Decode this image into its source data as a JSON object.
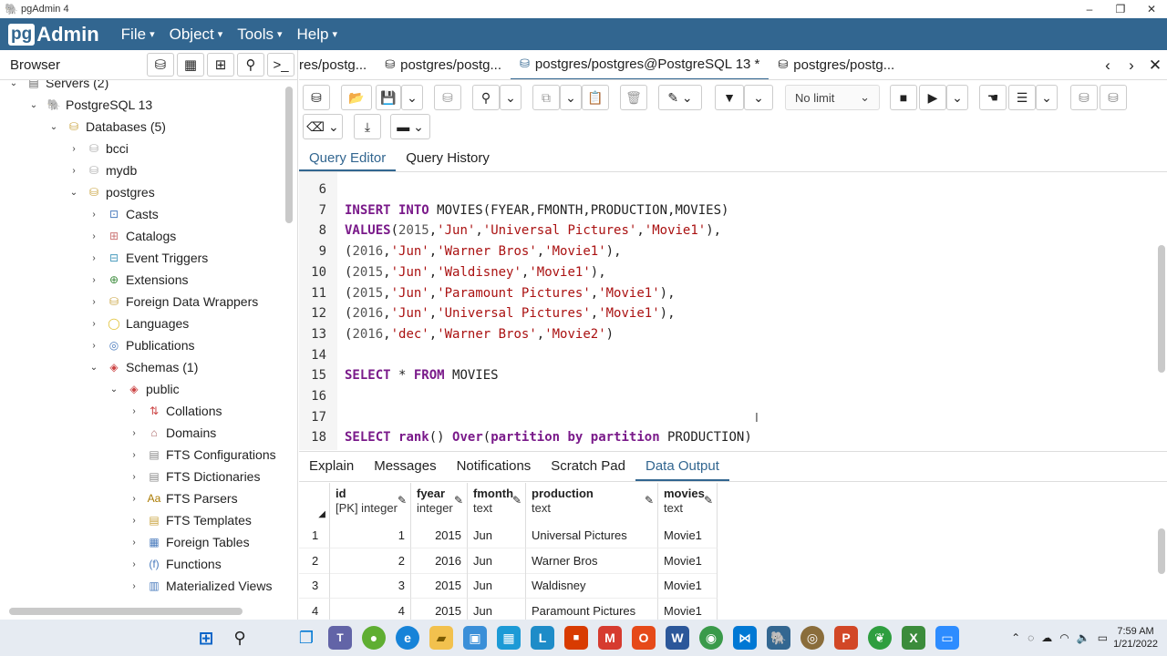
{
  "window": {
    "title": "pgAdmin 4",
    "min": "–",
    "max": "❐",
    "close": "✕"
  },
  "brand": {
    "pg": "pg",
    "admin": "Admin"
  },
  "menu": [
    {
      "label": "File"
    },
    {
      "label": "Object"
    },
    {
      "label": "Tools"
    },
    {
      "label": "Help"
    }
  ],
  "browser": {
    "title": "Browser",
    "tree": [
      {
        "label": "Servers (2)",
        "level": 0,
        "arrow": "⌄"
      },
      {
        "label": "PostgreSQL 13",
        "level": 1,
        "arrow": "⌄"
      },
      {
        "label": "Databases (5)",
        "level": 2,
        "arrow": "⌄"
      },
      {
        "label": "bcci",
        "level": 3,
        "arrow": "›"
      },
      {
        "label": "mydb",
        "level": 3,
        "arrow": "›"
      },
      {
        "label": "postgres",
        "level": 3,
        "arrow": "⌄"
      },
      {
        "label": "Casts",
        "level": 4,
        "arrow": "›"
      },
      {
        "label": "Catalogs",
        "level": 4,
        "arrow": "›"
      },
      {
        "label": "Event Triggers",
        "level": 4,
        "arrow": "›"
      },
      {
        "label": "Extensions",
        "level": 4,
        "arrow": "›"
      },
      {
        "label": "Foreign Data Wrappers",
        "level": 4,
        "arrow": "›"
      },
      {
        "label": "Languages",
        "level": 4,
        "arrow": "›"
      },
      {
        "label": "Publications",
        "level": 4,
        "arrow": "›"
      },
      {
        "label": "Schemas (1)",
        "level": 4,
        "arrow": "⌄"
      },
      {
        "label": "public",
        "level": 5,
        "arrow": "⌄"
      },
      {
        "label": "Collations",
        "level": 6,
        "arrow": "›"
      },
      {
        "label": "Domains",
        "level": 6,
        "arrow": "›"
      },
      {
        "label": "FTS Configurations",
        "level": 6,
        "arrow": "›"
      },
      {
        "label": "FTS Dictionaries",
        "level": 6,
        "arrow": "›"
      },
      {
        "label": "FTS Parsers",
        "level": 6,
        "arrow": "›"
      },
      {
        "label": "FTS Templates",
        "level": 6,
        "arrow": "›"
      },
      {
        "label": "Foreign Tables",
        "level": 6,
        "arrow": "›"
      },
      {
        "label": "Functions",
        "level": 6,
        "arrow": "›"
      },
      {
        "label": "Materialized Views",
        "level": 6,
        "arrow": "›"
      }
    ]
  },
  "tabs": [
    {
      "label": "res/postg..."
    },
    {
      "label": "postgres/postg..."
    },
    {
      "label": "postgres/postgres@PostgreSQL 13 *"
    },
    {
      "label": "postgres/postg..."
    }
  ],
  "toolbar": {
    "limit": "No limit"
  },
  "subtabs": [
    {
      "label": "Query Editor"
    },
    {
      "label": "Query History"
    }
  ],
  "editor": {
    "lines": [
      {
        "n": "6",
        "html": ""
      },
      {
        "n": "7",
        "html": "<span class='kw'>INSERT INTO</span> MOVIES(FYEAR,FMONTH,PRODUCTION,MOVIES)"
      },
      {
        "n": "8",
        "html": "<span class='kw'>VALUES</span>(<span class='num'>2015</span>,<span class='str'>'Jun'</span>,<span class='str'>'Universal Pictures'</span>,<span class='str'>'Movie1'</span>),"
      },
      {
        "n": "9",
        "html": "(<span class='num'>2016</span>,<span class='str'>'Jun'</span>,<span class='str'>'Warner Bros'</span>,<span class='str'>'Movie1'</span>),"
      },
      {
        "n": "10",
        "html": "(<span class='num'>2015</span>,<span class='str'>'Jun'</span>,<span class='str'>'Waldisney'</span>,<span class='str'>'Movie1'</span>),"
      },
      {
        "n": "11",
        "html": "(<span class='num'>2015</span>,<span class='str'>'Jun'</span>,<span class='str'>'Paramount Pictures'</span>,<span class='str'>'Movie1'</span>),"
      },
      {
        "n": "12",
        "html": "(<span class='num'>2016</span>,<span class='str'>'Jun'</span>,<span class='str'>'Universal Pictures'</span>,<span class='str'>'Movie1'</span>),"
      },
      {
        "n": "13",
        "html": "(<span class='num'>2016</span>,<span class='str'>'dec'</span>,<span class='str'>'Warner Bros'</span>,<span class='str'>'Movie2'</span>)"
      },
      {
        "n": "14",
        "html": ""
      },
      {
        "n": "15",
        "html": "<span class='kw'>SELECT</span> * <span class='kw'>FROM</span> MOVIES"
      },
      {
        "n": "16",
        "html": ""
      },
      {
        "n": "17",
        "html": ""
      },
      {
        "n": "18",
        "html": "<span class='kw'>SELECT</span> <span class='kw'>rank</span>() <span class='kw'>Over</span>(<span class='kw'>partition by partition</span> PRODUCTION)"
      }
    ]
  },
  "result_tabs": [
    {
      "label": "Explain"
    },
    {
      "label": "Messages"
    },
    {
      "label": "Notifications"
    },
    {
      "label": "Scratch Pad"
    },
    {
      "label": "Data Output"
    }
  ],
  "grid": {
    "columns": [
      {
        "name": "id",
        "type": "[PK] integer"
      },
      {
        "name": "fyear",
        "type": "integer"
      },
      {
        "name": "fmonth",
        "type": "text"
      },
      {
        "name": "production",
        "type": "text"
      },
      {
        "name": "movies",
        "type": "text"
      }
    ],
    "rows": [
      [
        "1",
        "1",
        "2015",
        "Jun",
        "Universal Pictures",
        "Movie1"
      ],
      [
        "2",
        "2",
        "2016",
        "Jun",
        "Warner Bros",
        "Movie1"
      ],
      [
        "3",
        "3",
        "2015",
        "Jun",
        "Waldisney",
        "Movie1"
      ],
      [
        "4",
        "4",
        "2015",
        "Jun",
        "Paramount Pictures",
        "Movie1"
      ]
    ]
  },
  "taskbar": {
    "time": "7:59 AM",
    "date": "1/21/2022"
  }
}
